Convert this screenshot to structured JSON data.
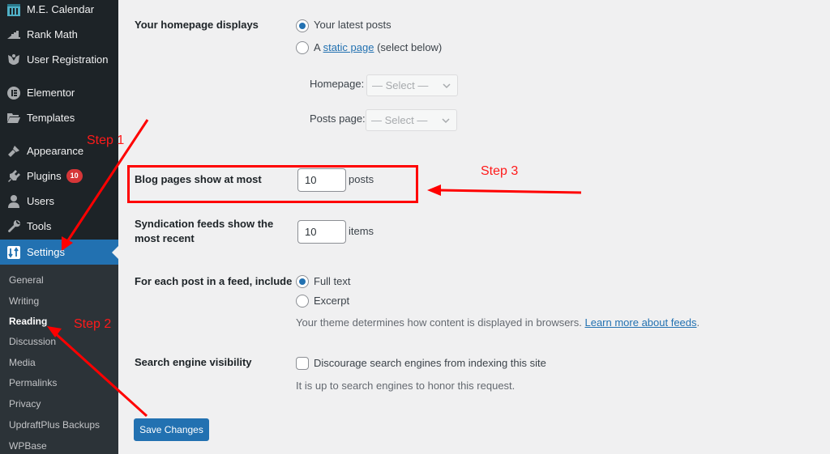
{
  "sidebar": {
    "items": [
      {
        "label": "M.E. Calendar",
        "icon": "calendar-icon"
      },
      {
        "label": "Rank Math",
        "icon": "chart-icon"
      },
      {
        "label": "User Registration",
        "icon": "user-registration-icon"
      },
      {
        "label": "Elementor",
        "icon": "elementor-icon"
      },
      {
        "label": "Templates",
        "icon": "folder-icon"
      },
      {
        "label": "Appearance",
        "icon": "paintbrush-icon"
      },
      {
        "label": "Plugins",
        "icon": "plugin-icon",
        "badge": "10"
      },
      {
        "label": "Users",
        "icon": "user-icon"
      },
      {
        "label": "Tools",
        "icon": "wrench-icon"
      },
      {
        "label": "Settings",
        "icon": "settings-icon",
        "active": true
      }
    ],
    "submenu": [
      {
        "label": "General"
      },
      {
        "label": "Writing"
      },
      {
        "label": "Reading",
        "current": true
      },
      {
        "label": "Discussion"
      },
      {
        "label": "Media"
      },
      {
        "label": "Permalinks"
      },
      {
        "label": "Privacy"
      },
      {
        "label": "UpdraftPlus Backups"
      },
      {
        "label": "WPBase"
      }
    ]
  },
  "form": {
    "homepage_displays": {
      "label": "Your homepage displays",
      "options": [
        {
          "label": "Your latest posts",
          "checked": true
        },
        {
          "prefix": "A ",
          "link": "static page",
          "suffix": " (select below)",
          "checked": false
        }
      ],
      "homepage_label": "Homepage:",
      "homepage_value": "— Select —",
      "posts_page_label": "Posts page:",
      "posts_page_value": "— Select —"
    },
    "blog_pages": {
      "label": "Blog pages show at most",
      "value": "10",
      "unit": "posts"
    },
    "syndication": {
      "label_line1": "Syndication feeds show the",
      "label_line2": "most recent",
      "value": "10",
      "unit": "items"
    },
    "feed_include": {
      "label": "For each post in a feed, include",
      "options": [
        {
          "label": "Full text",
          "checked": true
        },
        {
          "label": "Excerpt",
          "checked": false
        }
      ],
      "description": "Your theme determines how content is displayed in browsers. ",
      "link": "Learn more about feeds",
      "link_suffix": "."
    },
    "search_visibility": {
      "label": "Search engine visibility",
      "checkbox_label": "Discourage search engines from indexing this site",
      "checked": false,
      "description": "It is up to search engines to honor this request."
    },
    "save_label": "Save Changes"
  },
  "annotations": {
    "step1": "Step 1",
    "step2": "Step 2",
    "step3": "Step 3",
    "color": "#ff0000"
  }
}
